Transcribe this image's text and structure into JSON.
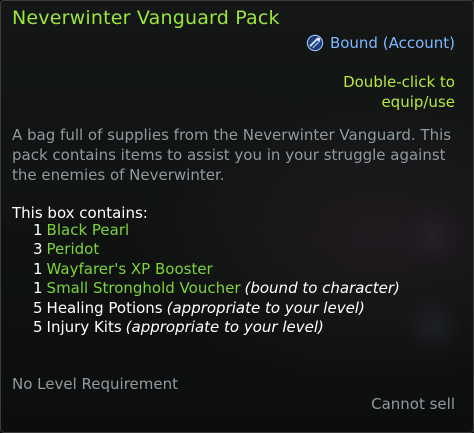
{
  "item": {
    "name": "Neverwinter Vanguard Pack",
    "binding": "Bound (Account)",
    "binding_icon": "bound-account-icon",
    "equip_hint": "Double-click to equip/use",
    "description": "A bag full of supplies from the Neverwinter Vanguard. This pack contains items to assist you in your struggle against the enemies of Neverwinter.",
    "contains_header": "This box contains:",
    "contents": [
      {
        "qty": "1",
        "name": "Black Pearl",
        "note": ""
      },
      {
        "qty": "3",
        "name": "Peridot",
        "note": ""
      },
      {
        "qty": "1",
        "name": "Wayfarer's XP Booster",
        "note": ""
      },
      {
        "qty": "1",
        "name": "Small Stronghold Voucher",
        "note": "(bound to character)"
      },
      {
        "qty": "5",
        "name": "Healing Potions",
        "note": "(appropriate to your level)"
      },
      {
        "qty": "5",
        "name": "Injury Kits",
        "note": "(appropriate to your level)"
      }
    ],
    "level_requirement": "No Level Requirement",
    "sell_status": "Cannot sell"
  },
  "colors": {
    "title": "#9be63a",
    "binding": "#7fb6ff",
    "equip_hint": "#b6ea3c",
    "description": "#8e9aa0",
    "item_green": "#7cd43a",
    "item_white": "#ffffff"
  }
}
